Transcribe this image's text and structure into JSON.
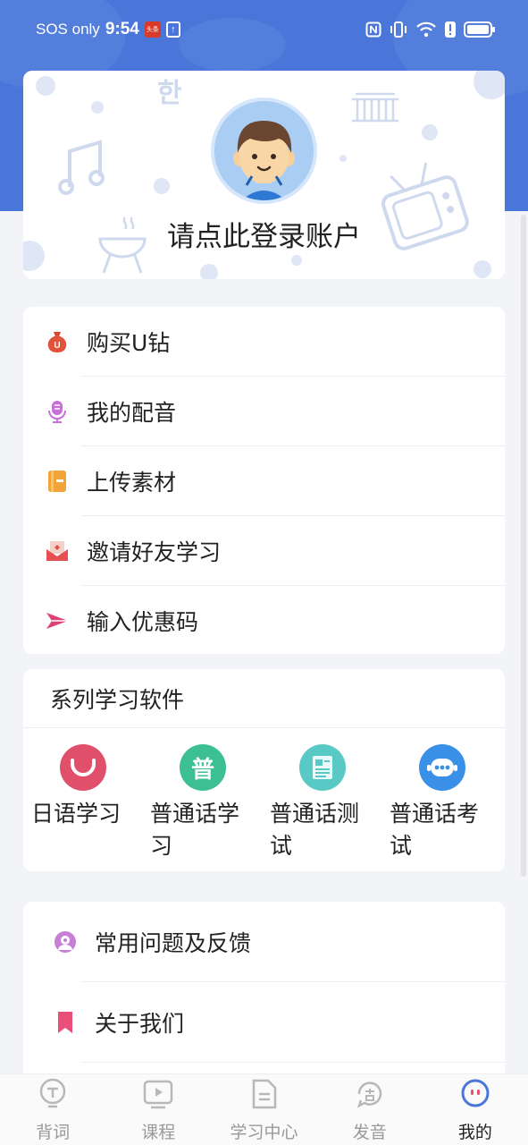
{
  "status_bar": {
    "carrier": "SOS only",
    "time": "9:54",
    "news_badge": "头条",
    "upload_glyph": "↑"
  },
  "profile": {
    "login_text": "请点此登录账户",
    "deco_text": "한"
  },
  "menu": [
    {
      "icon": "moneybag-icon",
      "label": "购买U钻",
      "color": "#e0533a"
    },
    {
      "icon": "microphone-icon",
      "label": "我的配音",
      "color": "#c86fd8"
    },
    {
      "icon": "notebook-icon",
      "label": "上传素材",
      "color": "#f0a43a"
    },
    {
      "icon": "invite-envelope-icon",
      "label": "邀请好友学习",
      "color": "#e65050"
    },
    {
      "icon": "paper-plane-icon",
      "label": "输入优惠码",
      "color": "#e0407a"
    }
  ],
  "series": {
    "title": "系列学习软件",
    "apps": [
      {
        "label": "日语学习",
        "icon": "smile-app-icon",
        "color": "#e0506a",
        "glyph": ""
      },
      {
        "label": "普通话学习",
        "icon": "putonghua-app-icon",
        "color": "#3dbf94",
        "glyph": "普"
      },
      {
        "label": "普通话测试",
        "icon": "test-paper-app-icon",
        "color": "#59c9c6",
        "glyph": ""
      },
      {
        "label": "普通话考试",
        "icon": "chat-bot-app-icon",
        "color": "#3a8fe6",
        "glyph": ""
      }
    ]
  },
  "more": [
    {
      "icon": "feedback-icon",
      "label": "常用问题及反馈",
      "color": "#c77fd8"
    },
    {
      "icon": "bookmark-icon",
      "label": "关于我们",
      "color": "#e8507a"
    }
  ],
  "tabs": [
    {
      "label": "背词",
      "icon": "lightbulb-icon",
      "active": false
    },
    {
      "label": "课程",
      "icon": "video-play-icon",
      "active": false
    },
    {
      "label": "学习中心",
      "icon": "document-icon",
      "active": false
    },
    {
      "label": "发音",
      "icon": "pronunciation-icon",
      "active": false
    },
    {
      "label": "我的",
      "icon": "profile-face-icon",
      "active": true
    }
  ],
  "colors": {
    "header_blue": "#4a76d9",
    "accent": "#4a76d9"
  }
}
